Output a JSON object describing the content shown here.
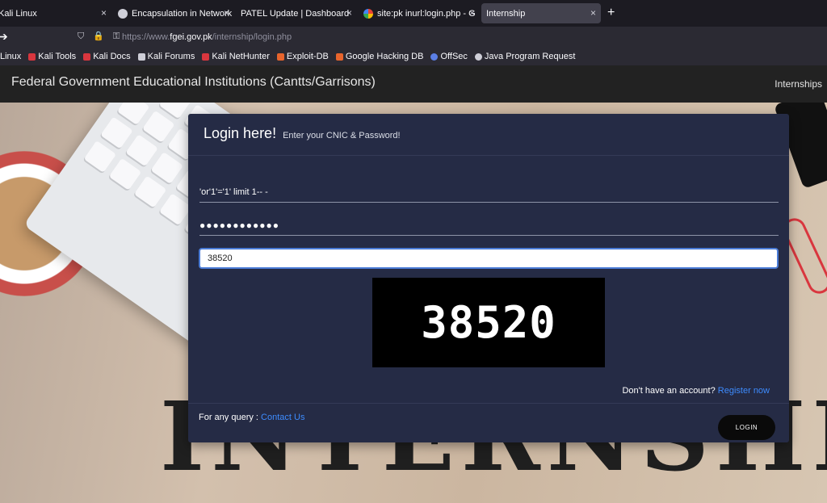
{
  "browser": {
    "tabs": [
      {
        "title": "Kali Linux",
        "active": false
      },
      {
        "title": "Encapsulation in Network",
        "active": false
      },
      {
        "title": "PATEL Update | Dashboard",
        "active": false
      },
      {
        "title": "site:pk inurl:login.php - G",
        "active": false
      },
      {
        "title": "Internship",
        "active": true
      }
    ],
    "tab_close_glyph": "×",
    "new_tab_glyph": "+",
    "url_prefix": "https://www.",
    "url_domain": "fgei.gov.pk",
    "url_path": "/internship/login.php",
    "bookmarks": [
      {
        "label": "Linux",
        "color": "#367bf0"
      },
      {
        "label": "Kali Tools",
        "color": "#d9363e"
      },
      {
        "label": "Kali Docs",
        "color": "#d9363e"
      },
      {
        "label": "Kali Forums",
        "color": "#cfcfd8"
      },
      {
        "label": "Kali NetHunter",
        "color": "#d9363e"
      },
      {
        "label": "Exploit-DB",
        "color": "#e8642c"
      },
      {
        "label": "Google Hacking DB",
        "color": "#e8642c"
      },
      {
        "label": "OffSec",
        "color": "#5b7fe6"
      },
      {
        "label": "Java Program Request",
        "color": "#cfcfd8"
      }
    ]
  },
  "site": {
    "brand": "Federal Government Educational Institutions (Cantts/Garrisons)",
    "nav_link": "Internships",
    "background_word": "INTERNSHIP"
  },
  "login": {
    "title": "Login here!",
    "subtitle": "Enter your CNIC & Password!",
    "cnic_value": "'or'1'='1' limit 1-- -",
    "password_value": "●●●●●●●●●●●●",
    "captcha_value": "38520",
    "captcha_image_text": "38520",
    "register_text": "Don't have an account?",
    "register_link": "Register now",
    "query_text": "For any query :",
    "contact_link": "Contact Us",
    "login_button": "LOGIN"
  }
}
